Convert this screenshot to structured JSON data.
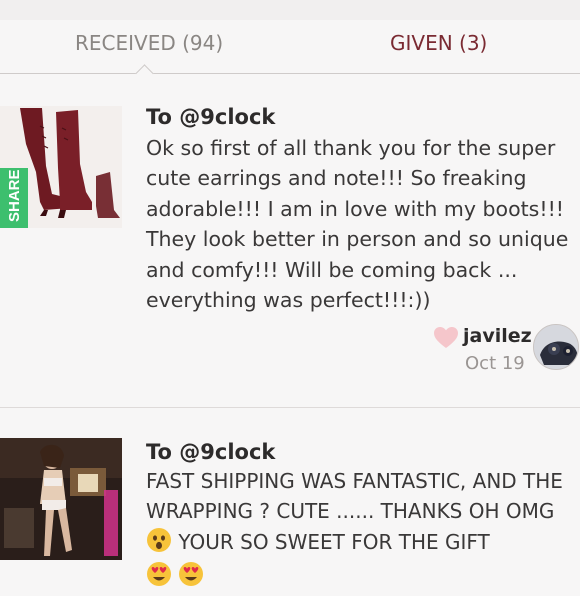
{
  "tabs": {
    "received": "RECEIVED (94)",
    "given": "GIVEN (3)",
    "active": "received"
  },
  "cards": [
    {
      "to": "To @9clock",
      "message": "Ok so first of all thank you for the super cute earrings and note!!! So freaking adorable!!! I am in love with my boots!!! They look better in person and so unique and comfy!!! Will be coming back ... everything was perfect!!!:))",
      "thumbnail_badge": "SHARE",
      "username": "javilez",
      "date": "Oct 19"
    },
    {
      "to": "To @9clock",
      "message_part1": "FAST SHIPPING WAS FANTASTIC, AND THE WRAPPING ? CUTE ...... THANKS OH OMG",
      "message_part2": "YOUR SO SWEET FOR THE GIFT"
    }
  ],
  "colors": {
    "given_tab": "#7a2a32",
    "received_tab": "#8a8683",
    "heart": "#f5c6cb",
    "share_badge": "#3dbf6e"
  },
  "icons": [
    "heart-icon",
    "astonished-face-emoji",
    "heart-eyes-emoji"
  ]
}
